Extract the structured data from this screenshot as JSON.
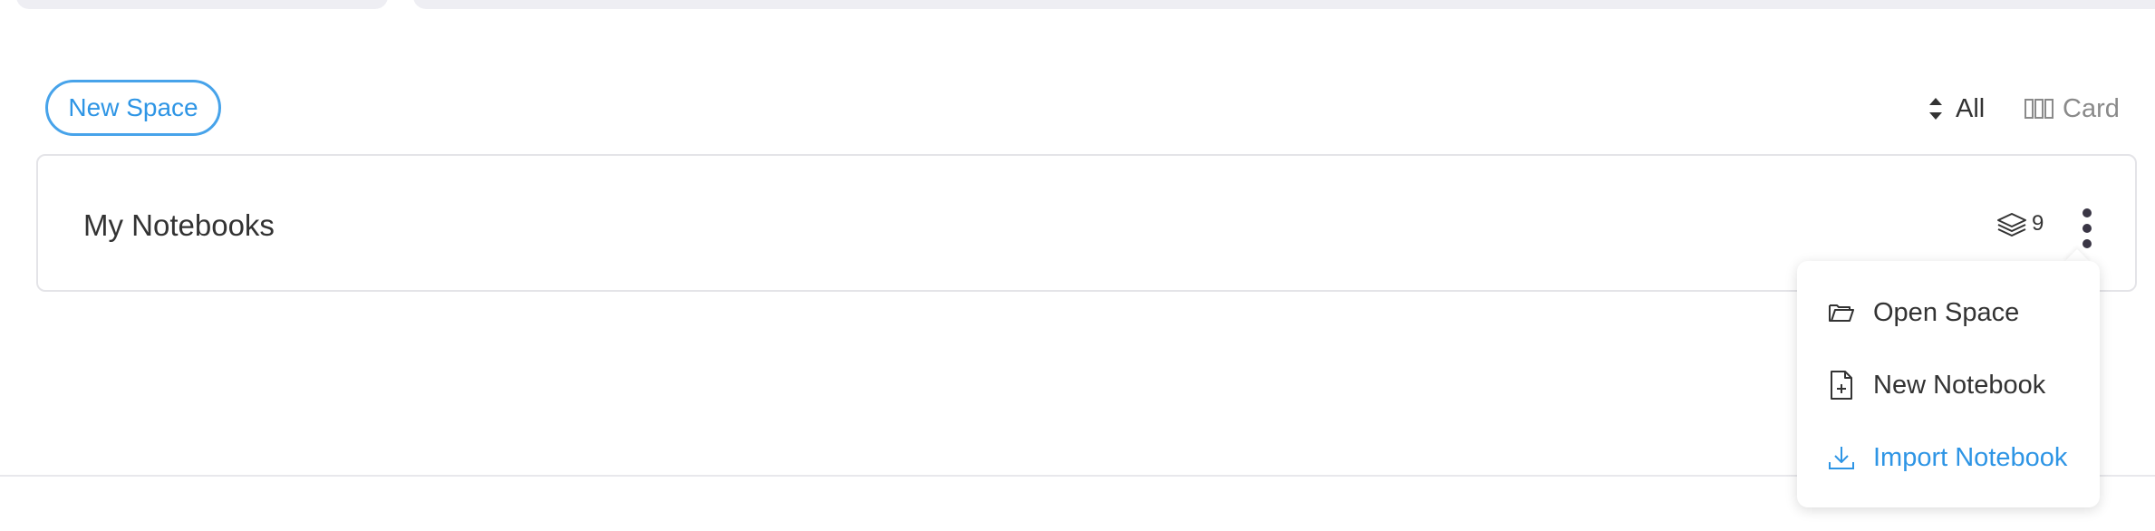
{
  "toolbar": {
    "new_space_label": "New Space",
    "sort_label": "All",
    "view_label": "Card"
  },
  "space": {
    "title": "My Notebooks",
    "notebook_count": "9"
  },
  "menu": {
    "items": [
      {
        "label": "Open Space",
        "icon": "folder-open-icon"
      },
      {
        "label": "New Notebook",
        "icon": "file-plus-icon"
      },
      {
        "label": "Import Notebook",
        "icon": "download-icon",
        "color": "#2e95e5"
      }
    ]
  },
  "colors": {
    "accent": "#2e95e5",
    "text": "#333333",
    "muted": "#8a8a8a",
    "border": "#e4e4e8"
  }
}
